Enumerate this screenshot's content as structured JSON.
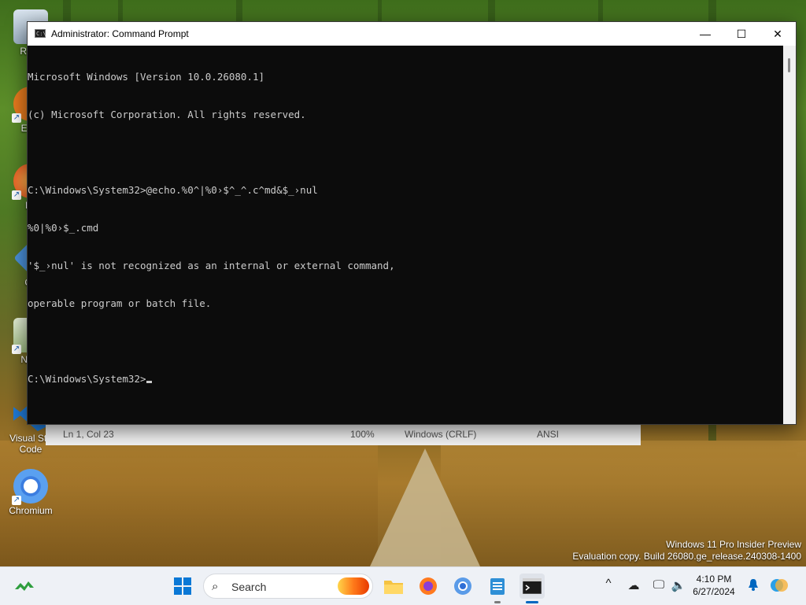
{
  "desktop": {
    "icons": [
      {
        "label": "Recy"
      },
      {
        "label": "Ever"
      },
      {
        "label": "Fir"
      },
      {
        "label": "Git"
      },
      {
        "label": "Note"
      },
      {
        "label": "Visual Stu"
      },
      {
        "label": "Code"
      },
      {
        "label": "Chromium"
      }
    ]
  },
  "notepad_status": {
    "position": "Ln 1, Col 23",
    "zoom": "100%",
    "line_endings": "Windows (CRLF)",
    "encoding": "ANSI"
  },
  "cmd": {
    "title": "Administrator: Command Prompt",
    "icon_glyph": "C:\\",
    "minimize": "—",
    "maximize": "☐",
    "close": "✕",
    "lines": [
      "Microsoft Windows [Version 10.0.26080.1]",
      "(c) Microsoft Corporation. All rights reserved.",
      "",
      "C:\\Windows\\System32>@echo.%0^|%0›$^_^.c^md&$_›nul",
      "%0|%0›$_.cmd",
      "'$_›nul' is not recognized as an internal or external command,",
      "operable program or batch file.",
      "",
      "C:\\Windows\\System32>"
    ]
  },
  "watermark": {
    "line1": "Windows 11 Pro Insider Preview",
    "line2": "Evaluation copy. Build 26080.ge_release.240308-1400"
  },
  "taskbar": {
    "search_placeholder": "Search",
    "time": "4:10 PM",
    "date": "6/27/2024",
    "tray_chevron": "^"
  },
  "colors": {
    "console_bg": "#0c0c0c",
    "console_fg": "#cccccc",
    "taskbar_bg": "#eef1f6",
    "accent": "#0067c0"
  }
}
